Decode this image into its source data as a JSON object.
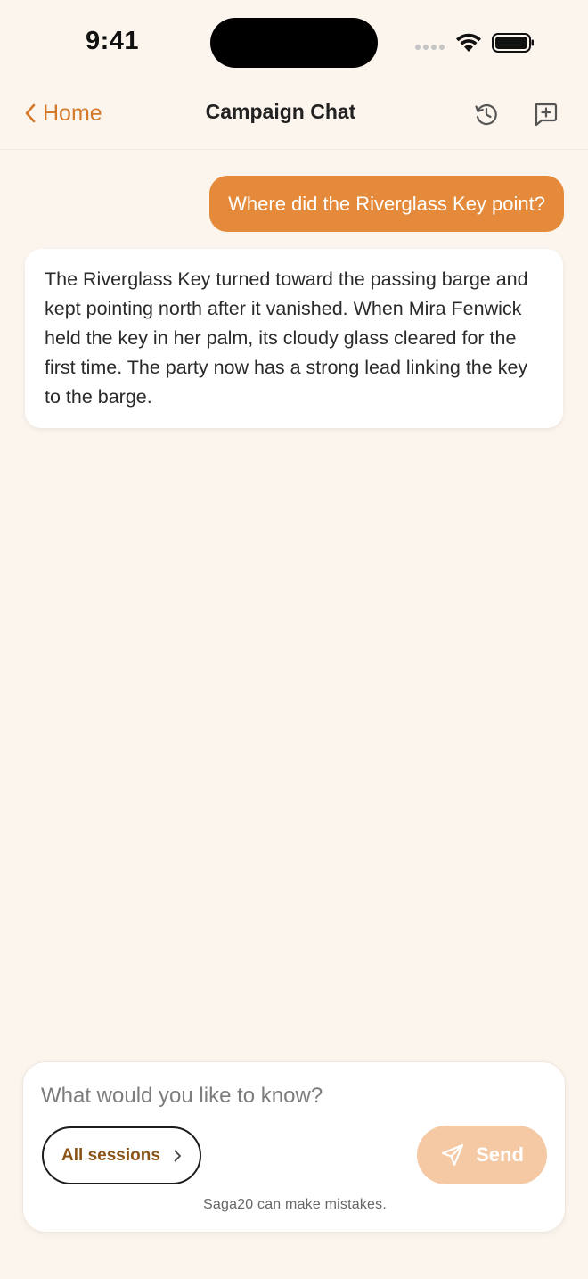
{
  "status_bar": {
    "time": "9:41"
  },
  "header": {
    "back_label": "Home",
    "title": "Campaign Chat",
    "icons": [
      "history-icon",
      "new-chat-icon"
    ]
  },
  "messages": [
    {
      "role": "user",
      "text": "Where did the Riverglass Key point?"
    },
    {
      "role": "assistant",
      "text": "The Riverglass Key turned toward the passing barge and kept pointing north after it vanished. When Mira Fenwick held the key in her palm, its cloudy glass cleared for the first time. The party now has a strong lead linking the key to the barge."
    }
  ],
  "composer": {
    "placeholder": "What would you like to know?",
    "value": "",
    "scope_label": "All sessions",
    "send_label": "Send",
    "disclaimer": "Saga20 can make mistakes."
  },
  "colors": {
    "accent": "#e48a3a",
    "accent_disabled": "#f4c9a3",
    "back_link": "#d4782a",
    "scope_text": "#8a5417",
    "background": "#fcf5ee"
  }
}
